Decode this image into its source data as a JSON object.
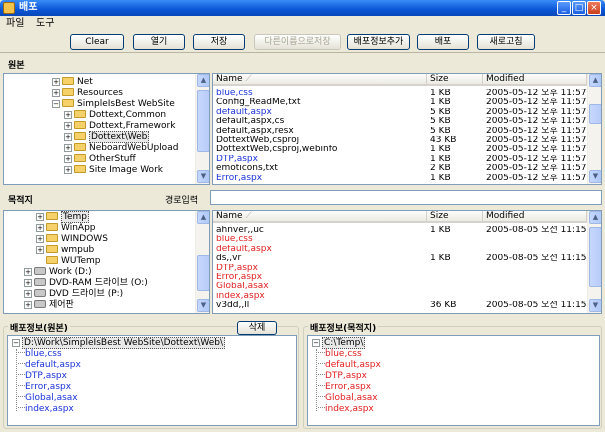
{
  "window": {
    "title": "배포",
    "icon": "app-icon"
  },
  "title_buttons": {
    "minimize": "_",
    "maximize": "□",
    "close": "×"
  },
  "menu": [
    "파일",
    "도구"
  ],
  "toolbar": {
    "clear": "Clear",
    "open": "열기",
    "save": "저장",
    "save_as": "다른이름으로저장",
    "deploy_info": "배포정보추가",
    "deploy": "배포",
    "refresh": "새로고침"
  },
  "source": {
    "label": "원본",
    "tree": [
      {
        "label": "Net",
        "level": 0,
        "expander": "+"
      },
      {
        "label": "Resources",
        "level": 0,
        "expander": "+"
      },
      {
        "label": "SimpleIsBest WebSite",
        "level": 0,
        "expander": "−"
      },
      {
        "label": "Dottext,Common",
        "level": 1,
        "expander": "+"
      },
      {
        "label": "Dottext,Framework",
        "level": 1,
        "expander": "+"
      },
      {
        "label": "Dottext\\Web",
        "level": 1,
        "expander": "+",
        "selected": true
      },
      {
        "label": "NeboardWebUpload",
        "level": 1,
        "expander": "+"
      },
      {
        "label": "OtherStuff",
        "level": 1,
        "expander": "+"
      },
      {
        "label": "Site Image Work",
        "level": 1,
        "expander": "+"
      }
    ],
    "columns": [
      "Name",
      "Size",
      "Modified"
    ],
    "files": [
      {
        "name": "blue,css",
        "size": "1 KB",
        "modified": "2005-05-12 오후 11:57",
        "color": "blue"
      },
      {
        "name": "Config_ReadMe,txt",
        "size": "1 KB",
        "modified": "2005-05-12 오후 11:57",
        "color": "black"
      },
      {
        "name": "default,aspx",
        "size": "5 KB",
        "modified": "2005-05-12 오후 11:57",
        "color": "blue"
      },
      {
        "name": "default,aspx,cs",
        "size": "5 KB",
        "modified": "2005-05-12 오후 11:57",
        "color": "black"
      },
      {
        "name": "default,aspx,resx",
        "size": "5 KB",
        "modified": "2005-05-12 오후 11:57",
        "color": "black"
      },
      {
        "name": "DottextWeb,csproj",
        "size": "43 KB",
        "modified": "2005-05-12 오후 11:57",
        "color": "black"
      },
      {
        "name": "DottextWeb,csproj,webinfo",
        "size": "1 KB",
        "modified": "2005-05-12 오후 11:57",
        "color": "black"
      },
      {
        "name": "DTP,aspx",
        "size": "1 KB",
        "modified": "2005-05-12 오후 11:57",
        "color": "blue"
      },
      {
        "name": "emoticons,txt",
        "size": "2 KB",
        "modified": "2005-05-12 오후 11:57",
        "color": "black"
      },
      {
        "name": "Error,aspx",
        "size": "1 KB",
        "modified": "2005-05-12 오후 11:57",
        "color": "blue"
      }
    ]
  },
  "target": {
    "label": "목적지",
    "path_label": "경로입력",
    "path_value": "",
    "tree": [
      {
        "label": "Temp",
        "level": 1,
        "expander": "+",
        "icon": "folder",
        "selected": true
      },
      {
        "label": "WinApp",
        "level": 1,
        "expander": "+",
        "icon": "folder"
      },
      {
        "label": "WINDOWS",
        "level": 1,
        "expander": "+",
        "icon": "folder"
      },
      {
        "label": "wmpub",
        "level": 1,
        "expander": "+",
        "icon": "folder"
      },
      {
        "label": "WUTemp",
        "level": 1,
        "expander": "",
        "icon": "folder"
      },
      {
        "label": "Work (D:)",
        "level": 0,
        "expander": "+",
        "icon": "drive"
      },
      {
        "label": "DVD-RAM 드라이브 (O:)",
        "level": 0,
        "expander": "+",
        "icon": "drive"
      },
      {
        "label": "DVD 드라이브 (P:)",
        "level": 0,
        "expander": "+",
        "icon": "drive"
      },
      {
        "label": "제어판",
        "level": 0,
        "expander": "+",
        "icon": "drive"
      }
    ],
    "columns": [
      "Name",
      "Size",
      "Modified"
    ],
    "files": [
      {
        "name": "ahnver,,uc",
        "size": "1 KB",
        "modified": "2005-08-05 오전 11:15",
        "color": "black"
      },
      {
        "name": "blue,css",
        "size": "",
        "modified": "",
        "color": "red"
      },
      {
        "name": "default,aspx",
        "size": "",
        "modified": "",
        "color": "red"
      },
      {
        "name": "ds,,vr",
        "size": "1 KB",
        "modified": "2005-08-05 오전 11:15",
        "color": "black"
      },
      {
        "name": "DTP,aspx",
        "size": "",
        "modified": "",
        "color": "red"
      },
      {
        "name": "Error,aspx",
        "size": "",
        "modified": "",
        "color": "red"
      },
      {
        "name": "Global,asax",
        "size": "",
        "modified": "",
        "color": "red"
      },
      {
        "name": "index,aspx",
        "size": "",
        "modified": "",
        "color": "red"
      },
      {
        "name": "v3dd,,ll",
        "size": "36 KB",
        "modified": "2005-08-05 오전 11:15",
        "color": "black"
      }
    ]
  },
  "deploy_source": {
    "title": "배포정보(원본)",
    "delete_button": "삭제",
    "root": "D:\\Work\\SimpleIsBest WebSite\\Dottext\\Web\\",
    "items": [
      "blue,css",
      "default,aspx",
      "DTP,aspx",
      "Error,aspx",
      "Global,asax",
      "index,aspx"
    ],
    "item_color": "#1a33d8"
  },
  "deploy_target": {
    "title": "배포정보(목적지)",
    "root": "C:\\Temp\\",
    "items": [
      "blue,css",
      "default,aspx",
      "DTP,aspx",
      "Error,aspx",
      "Global,asax",
      "index,aspx"
    ],
    "item_color": "#e02020"
  }
}
